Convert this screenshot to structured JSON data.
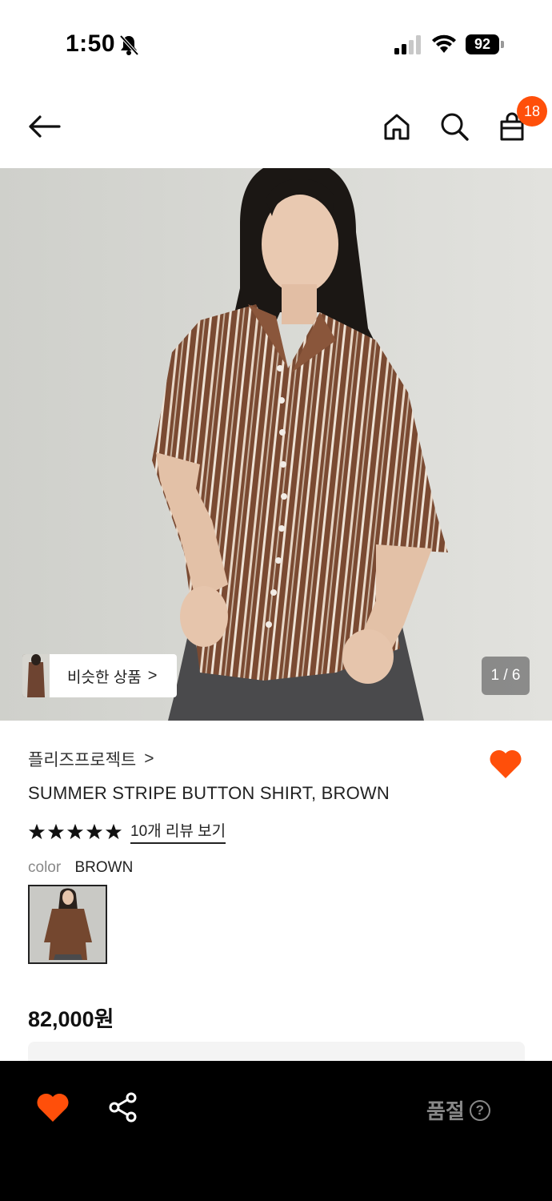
{
  "status_bar": {
    "time": "1:50",
    "battery": "92"
  },
  "header": {
    "cart_count": "18"
  },
  "gallery": {
    "similar_label": "비슷한 상품",
    "similar_chevron": ">",
    "counter": "1 / 6"
  },
  "product": {
    "brand": "플리즈프로젝트",
    "brand_chevron": ">",
    "name": "SUMMER STRIPE BUTTON SHIRT, BROWN",
    "rating": 5,
    "review_link": "10개 리뷰 보기",
    "color_label": "color",
    "color_value": "BROWN",
    "price": "82,000원"
  },
  "bottom_bar": {
    "soldout_label": "품절",
    "help": "?"
  },
  "colors": {
    "accent": "#ff4f0a",
    "bottom_bar": "#000000"
  }
}
